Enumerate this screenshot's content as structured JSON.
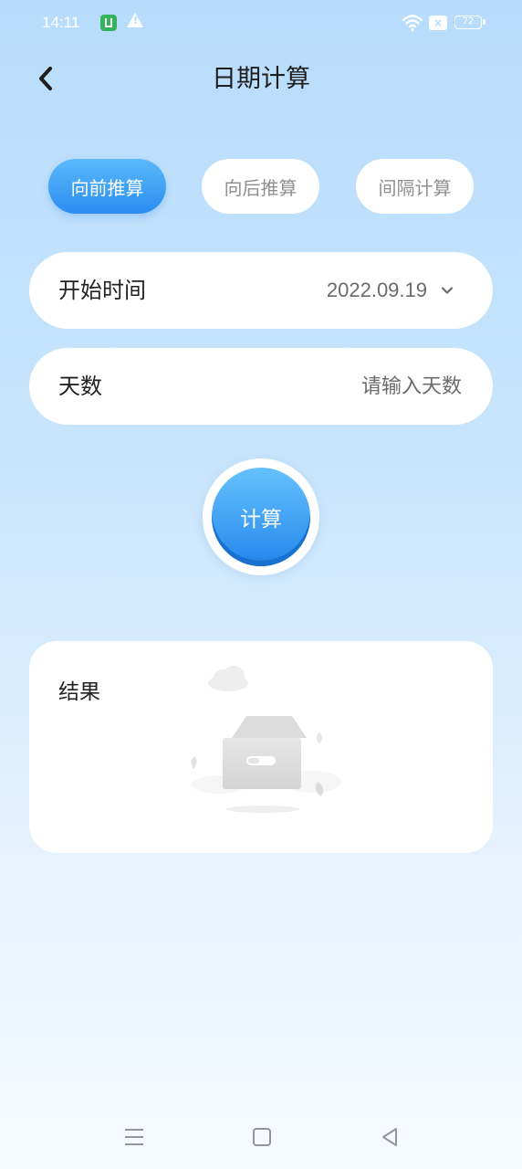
{
  "status_bar": {
    "time": "14:11",
    "battery": "72"
  },
  "header": {
    "title": "日期计算"
  },
  "tabs": [
    {
      "label": "向前推算",
      "active": true
    },
    {
      "label": "向后推算",
      "active": false
    },
    {
      "label": "间隔计算",
      "active": false
    }
  ],
  "form": {
    "start_time": {
      "label": "开始时间",
      "value": "2022.09.19"
    },
    "days": {
      "label": "天数",
      "placeholder": "请输入天数"
    }
  },
  "calculate_button": {
    "label": "计算"
  },
  "result": {
    "label": "结果"
  },
  "colors": {
    "accent": "#2b8df0",
    "background_top": "#b7dcfb",
    "card": "#ffffff"
  }
}
